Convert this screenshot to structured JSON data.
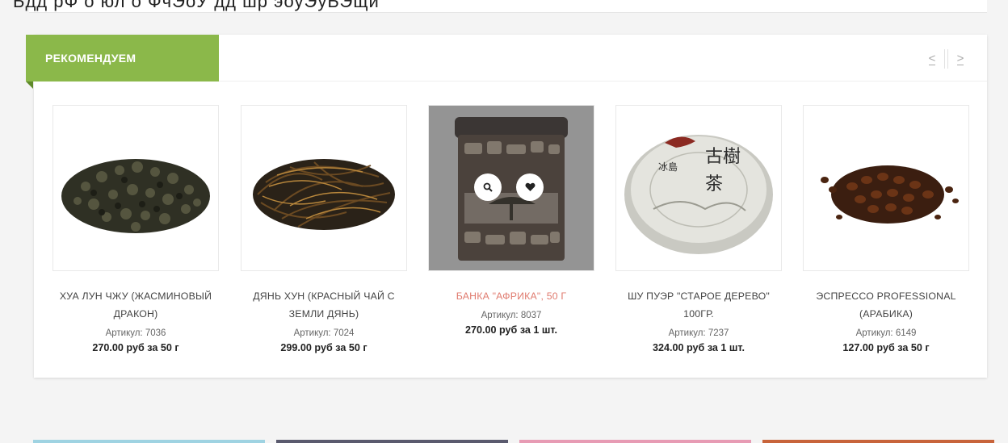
{
  "top_strip": {
    "cut_text": "Ьдд рФ о юл о ФчЭоУ дд шр эоуЭуЬЭщй"
  },
  "section": {
    "title": "РЕКОМЕНДУЕМ",
    "prev_label": "<",
    "next_label": ">"
  },
  "products": [
    {
      "name": "ХУА ЛУН ЧЖУ (ЖАСМИНОВЫЙ ДРАКОН)",
      "article": "Артикул: 7036",
      "price": "270.00 руб за 50 г"
    },
    {
      "name": "ДЯНЬ ХУН (КРАСНЫЙ ЧАЙ С ЗЕМЛИ ДЯНЬ)",
      "article": "Артикул: 7024",
      "price": "299.00 руб за 50 г"
    },
    {
      "name": "БАНКА \"АФРИКА\", 50 Г",
      "article": "Артикул: 8037",
      "price": "270.00 руб за 1 шт."
    },
    {
      "name": "ШУ ПУЭР \"СТАРОЕ ДЕРЕВО\" 100ГР.",
      "article": "Артикул: 7237",
      "price": "324.00 руб за 1 шт."
    },
    {
      "name": "ЭСПРЕССО PROFESSIONAL (АРАБИКА)",
      "article": "Артикул: 6149",
      "price": "127.00 руб за 50 г"
    }
  ],
  "colors": {
    "accent_green": "#8bb84a",
    "highlight_name": "#e07b6f",
    "bottom_bars": [
      "#9fd3e2",
      "#5a5a6e",
      "#e79bb4",
      "#c8643b"
    ]
  },
  "icons": {
    "quick_view": "search-icon",
    "favorite": "heart-icon"
  }
}
